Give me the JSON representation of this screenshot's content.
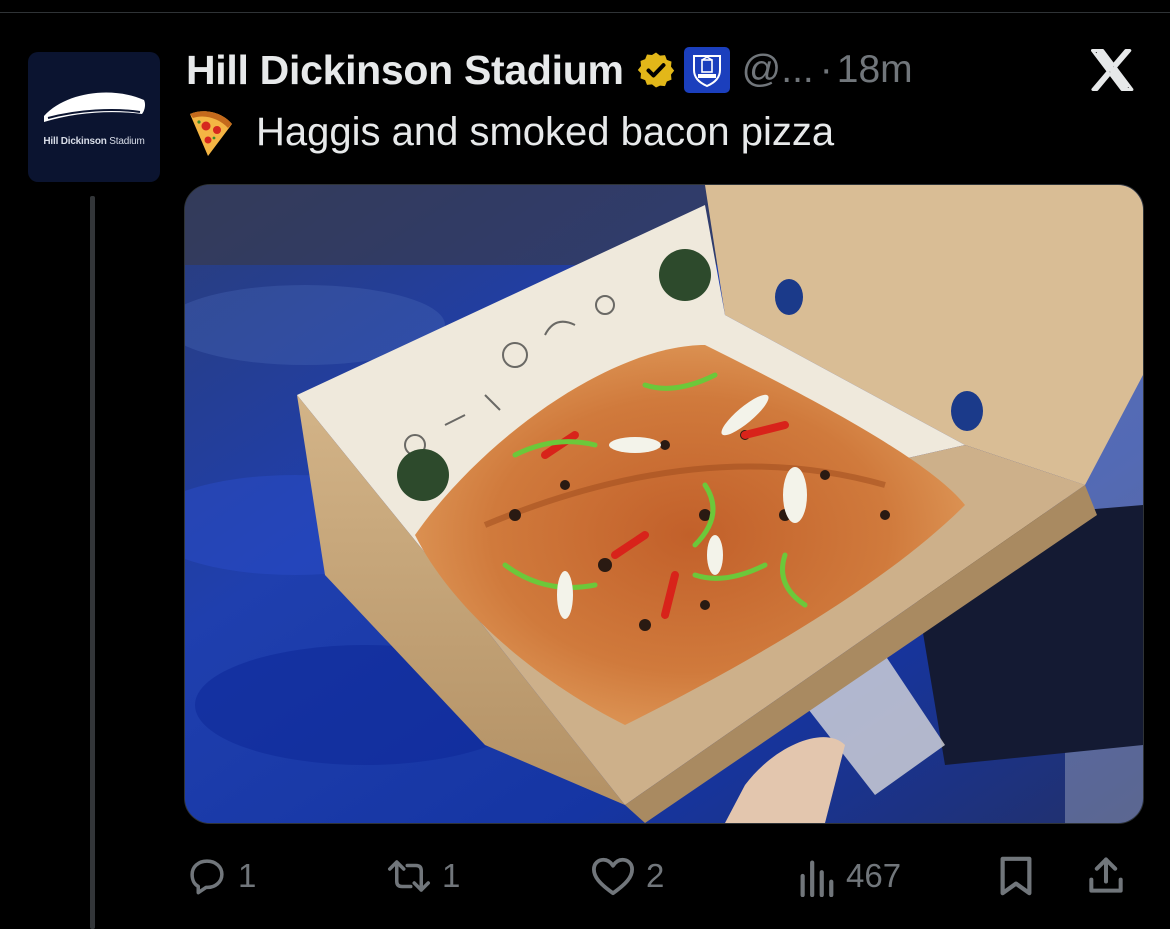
{
  "post": {
    "display_name": "Hill Dickinson Stadium",
    "handle": "@...",
    "separator": "·",
    "time": "18m",
    "text": "Haggis and smoked bacon pizza",
    "emoji": "pizza-emoji",
    "avatar_text_bold": "Hill Dickinson",
    "avatar_text_light": " Stadium",
    "verified_badge": "gold-verified-icon",
    "affiliate_badge": "everton-crest-icon"
  },
  "media": {
    "description": "pizza-photo",
    "accent_colors": {
      "seats": "#1d3aa0",
      "box": "#c9a87c"
    }
  },
  "actions": {
    "reply_count": "1",
    "repost_count": "1",
    "like_count": "2",
    "view_count": "467"
  },
  "colors": {
    "background": "#000000",
    "text": "#e7e9ea",
    "muted": "#71767b",
    "verified": "#e2b719",
    "divider": "#2f3336"
  }
}
